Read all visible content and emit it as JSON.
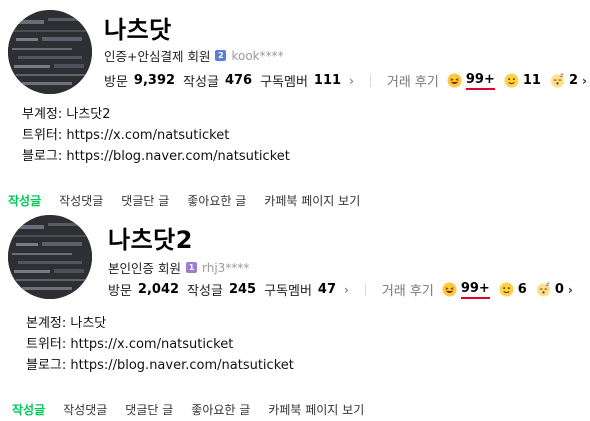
{
  "profiles": [
    {
      "nickname": "나츠닷",
      "grade": "인증+안심결제 회원",
      "grade_badge": "2",
      "grade_badge_color": "#5b7fd6",
      "user_id": "kook****",
      "stats": [
        {
          "label": "방문",
          "value": "9,392"
        },
        {
          "label": "작성글",
          "value": "476"
        },
        {
          "label": "구독멤버",
          "value": "111"
        }
      ],
      "review_label": "거래 후기",
      "reviews": [
        {
          "icon": "laughing-emoji-icon",
          "value": "99+"
        },
        {
          "icon": "smiling-emoji-icon",
          "value": "11"
        },
        {
          "icon": "sleepy-emoji-icon",
          "value": "2"
        }
      ],
      "links": [
        "부계정: 나츠닷2",
        "트위터: https://x.com/natsuticket",
        "블로그: https://blog.naver.com/natsuticket"
      ],
      "tabs": [
        "작성글",
        "작성댓글",
        "댓글단 글",
        "좋아요한 글",
        "카페북 페이지 보기"
      ]
    },
    {
      "nickname": "나츠닷2",
      "grade": "본인인증 회원",
      "grade_badge": "1",
      "grade_badge_color": "#9b7fd0",
      "user_id": "rhj3****",
      "stats": [
        {
          "label": "방문",
          "value": "2,042"
        },
        {
          "label": "작성글",
          "value": "245"
        },
        {
          "label": "구독멤버",
          "value": "47"
        }
      ],
      "review_label": "거래 후기",
      "reviews": [
        {
          "icon": "laughing-emoji-icon",
          "value": "99+"
        },
        {
          "icon": "smiling-emoji-icon",
          "value": "6"
        },
        {
          "icon": "sleepy-emoji-icon",
          "value": "0"
        }
      ],
      "links": [
        "본계정: 나츠닷",
        "트위터: https://x.com/natsuticket",
        "블로그: https://blog.naver.com/natsuticket"
      ],
      "tabs": [
        "작성글",
        "작성댓글",
        "댓글단 글",
        "좋아요한 글",
        "카페북 페이지 보기"
      ]
    }
  ],
  "colors": {
    "active_tab": "#03c75a",
    "review_underline": "#e0002a"
  }
}
